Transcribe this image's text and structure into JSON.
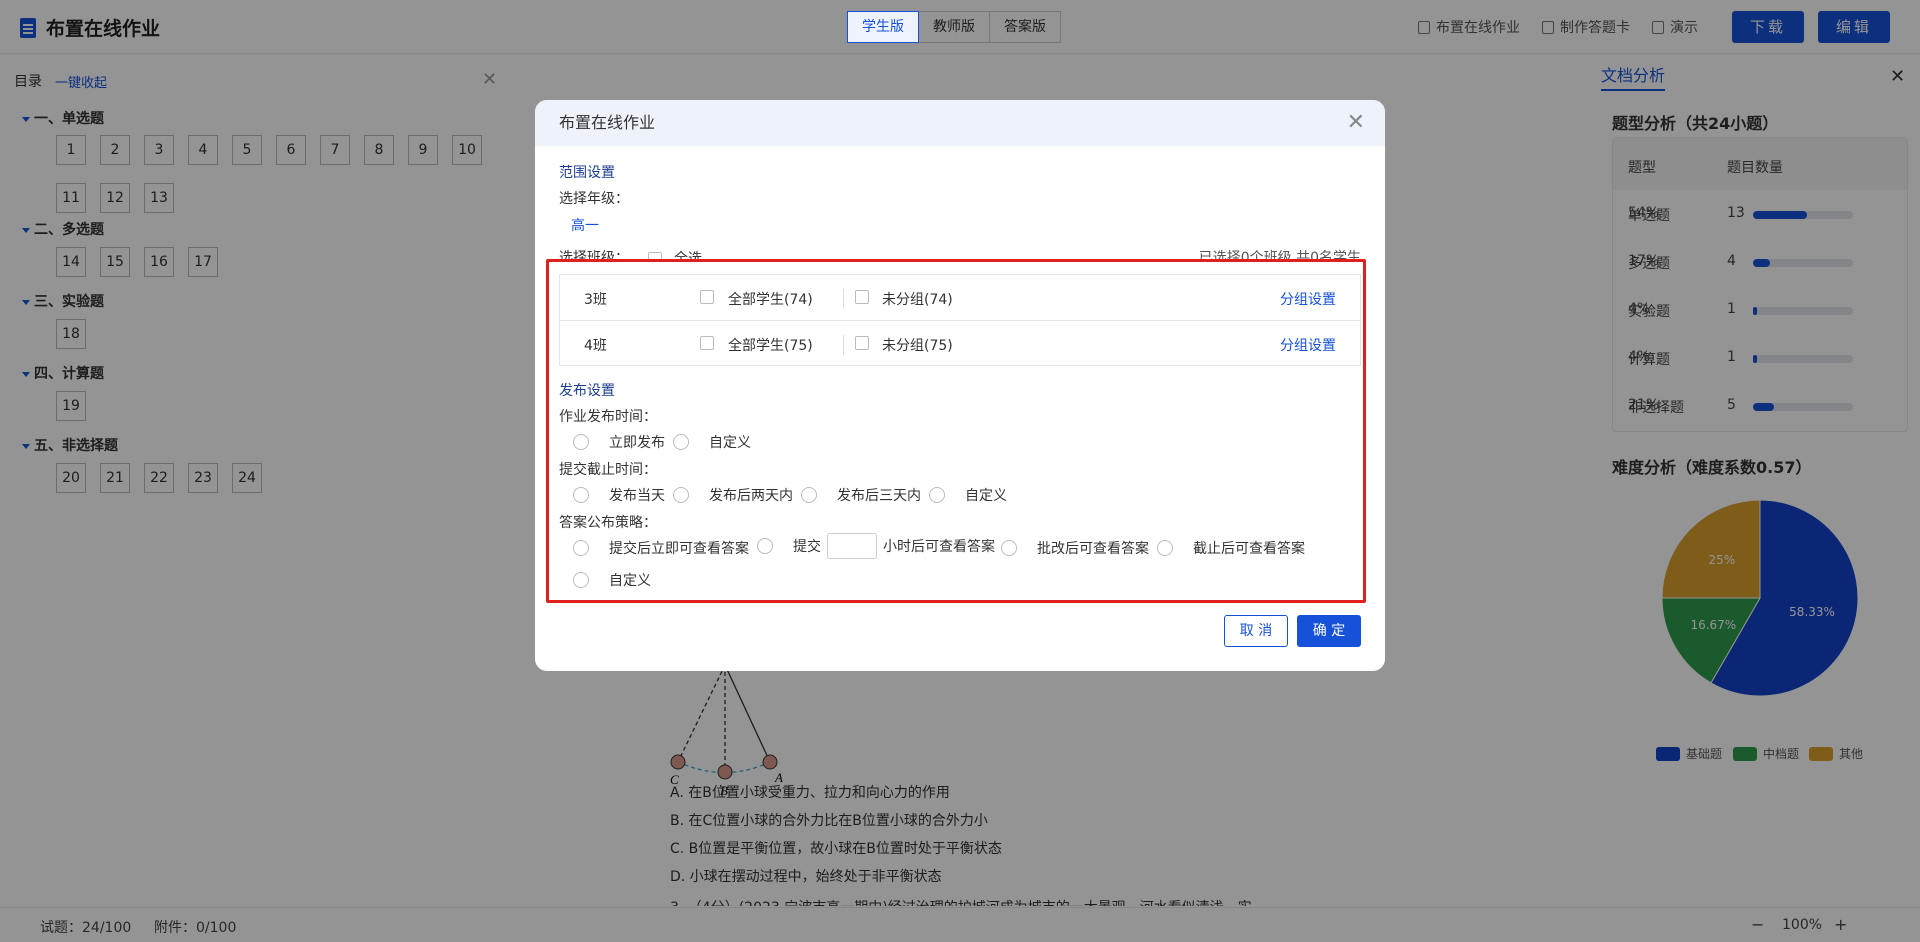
{
  "app": {
    "title": "布置在线作业"
  },
  "version_tabs": [
    {
      "label": "学生版",
      "active": true
    },
    {
      "label": "教师版",
      "active": false
    },
    {
      "label": "答案版",
      "active": false
    }
  ],
  "top_actions": {
    "assign": "布置在线作业",
    "answer_card": "制作答题卡",
    "present": "演示",
    "download": "下载",
    "edit": "编辑"
  },
  "toc": {
    "title": "目录",
    "collapse": "一键收起",
    "sections": [
      {
        "title": "一、单选题",
        "items": [
          "1",
          "2",
          "3",
          "4",
          "5",
          "6",
          "7",
          "8",
          "9",
          "10",
          "11",
          "12",
          "13"
        ]
      },
      {
        "title": "二、多选题",
        "items": [
          "14",
          "15",
          "16",
          "17"
        ]
      },
      {
        "title": "三、实验题",
        "items": [
          "18"
        ]
      },
      {
        "title": "四、计算题",
        "items": [
          "19"
        ]
      },
      {
        "title": "五、非选择题",
        "items": [
          "20",
          "21",
          "22",
          "23",
          "24"
        ]
      }
    ]
  },
  "content": {
    "figure_labels": [
      "C",
      "B",
      "A"
    ],
    "options": [
      "A. 在B位置小球受重力、拉力和向心力的作用",
      "B. 在C位置小球的合外力比在B位置小球的合外力小",
      "C. B位置是平衡位置，故小球在B位置时处于平衡状态",
      "D. 小球在摆动过程中，始终处于非平衡状态"
    ],
    "next_question": "3. （4分）(2023·宁波市高一期中)经过治理的护城河成为城市的一大景观，河水看似清浅，实"
  },
  "analysis": {
    "tab": "文档分析",
    "type_title": "题型分析（共24小题）",
    "columns": [
      "题型",
      "题目数量"
    ],
    "rows": [
      {
        "type": "单选题",
        "count": "13",
        "pct": "54%",
        "ratio": 0.54
      },
      {
        "type": "多选题",
        "count": "4",
        "pct": "17%",
        "ratio": 0.17
      },
      {
        "type": "实验题",
        "count": "1",
        "pct": "4%",
        "ratio": 0.04
      },
      {
        "type": "计算题",
        "count": "1",
        "pct": "4%",
        "ratio": 0.04
      },
      {
        "type": "非选择题",
        "count": "5",
        "pct": "21%",
        "ratio": 0.21
      }
    ],
    "difficulty_title": "难度分析（难度系数0.57）"
  },
  "chart_data": {
    "type": "pie",
    "slices": [
      {
        "label": "基础题",
        "value": 58.33,
        "text": "58.33%",
        "color": "#1243c9"
      },
      {
        "label": "中档题",
        "value": 16.67,
        "text": "16.67%",
        "color": "#2e9c4e"
      },
      {
        "label": "其他",
        "value": 25,
        "text": "25%",
        "color": "#d9a030"
      }
    ]
  },
  "footer": {
    "questions": "试题：24/100",
    "attachments": "附件：0/100",
    "zoom_minus": "−",
    "zoom": "100%",
    "zoom_plus": "+"
  },
  "modal": {
    "title": "布置在线作业",
    "range_section": "范围设置",
    "grade_label": "选择年级：",
    "grade_value": "高一",
    "class_label": "选择班级：",
    "select_all": "全选",
    "selected_summary": "已选择0个班级,共0名学生",
    "classes": [
      {
        "name": "3班",
        "all": "全部学生(74)",
        "ungrouped": "未分组(74)",
        "group_link": "分组设置"
      },
      {
        "name": "4班",
        "all": "全部学生(75)",
        "ungrouped": "未分组(75)",
        "group_link": "分组设置"
      }
    ],
    "publish_section": "发布设置",
    "publish_time_label": "作业发布时间：",
    "publish_options": [
      "立即发布",
      "自定义"
    ],
    "deadline_label": "提交截止时间：",
    "deadline_options": [
      "发布当天",
      "发布后两天内",
      "发布后三天内",
      "自定义"
    ],
    "answer_label": "答案公布策略：",
    "answer_options": {
      "immediate": "提交后立即可查看答案",
      "hours_prefix": "提交",
      "hours_suffix": "小时后可查看答案",
      "after_grading": "批改后可查看答案",
      "after_deadline": "截止后可查看答案",
      "custom": "自定义"
    },
    "cancel": "取 消",
    "confirm": "确 定"
  }
}
